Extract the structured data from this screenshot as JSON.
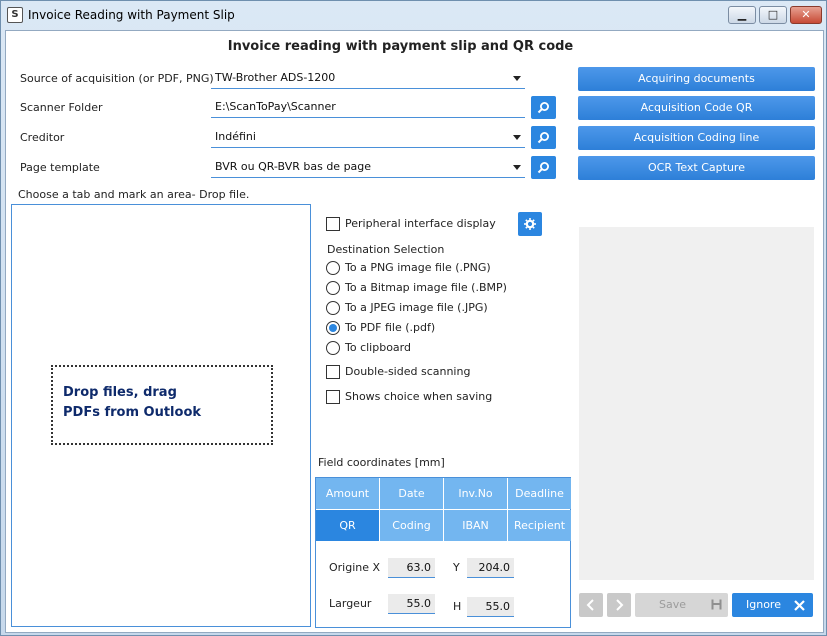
{
  "window": {
    "title": "Invoice Reading with Payment Slip",
    "controls": {
      "minimize": "▁",
      "maximize": "□",
      "close": "✕"
    }
  },
  "heading": "Invoice reading with payment slip and QR code",
  "form": {
    "source_label": "Source of acquisition (or PDF, PNG)",
    "source_value": "TW-Brother ADS-1200",
    "folder_label": "Scanner Folder",
    "folder_value": "E:\\ScanToPay\\Scanner",
    "creditor_label": "Creditor",
    "creditor_value": "Indéfini",
    "template_label": "Page template",
    "template_value": "BVR ou QR-BVR bas de page"
  },
  "actions": {
    "acquire": "Acquiring documents",
    "qr": "Acquisition Code QR",
    "coding_line": "Acquisition Coding line",
    "ocr": "OCR Text Capture"
  },
  "dropzone": {
    "hint": "Choose a tab and mark an area- Drop file.",
    "line1": "Drop files, drag",
    "line2": "PDFs from Outlook"
  },
  "options": {
    "peripheral": {
      "label": "Peripheral interface display",
      "checked": false
    },
    "destination_title": "Destination Selection",
    "destinations": [
      {
        "label": "To a PNG image file (.PNG)",
        "selected": false
      },
      {
        "label": "To a Bitmap image file (.BMP)",
        "selected": false
      },
      {
        "label": "To a JPEG image file (.JPG)",
        "selected": false
      },
      {
        "label": "To PDF file (.pdf)",
        "selected": true
      },
      {
        "label": "To clipboard",
        "selected": false
      }
    ],
    "double_sided": {
      "label": "Double-sided scanning",
      "checked": false
    },
    "shows_choice": {
      "label": "Shows choice when saving",
      "checked": false
    }
  },
  "coords": {
    "title": "Field coordinates [mm]",
    "tabs": [
      "Amount",
      "Date",
      "Inv.No",
      "Deadline",
      "QR",
      "Coding",
      "IBAN",
      "Recipient"
    ],
    "active_tab": "QR",
    "origin_x_label": "Origine X",
    "origin_x": "63.0",
    "y_label": "Y",
    "y": "204.0",
    "width_label": "Largeur",
    "width": "55.0",
    "h_label": "H",
    "h": "55.0"
  },
  "footer": {
    "save": "Save",
    "ignore": "Ignore"
  },
  "colors": {
    "accent": "#2b86e0",
    "tab_inactive": "#73b6f0",
    "drop_text": "#0e2a6b"
  }
}
